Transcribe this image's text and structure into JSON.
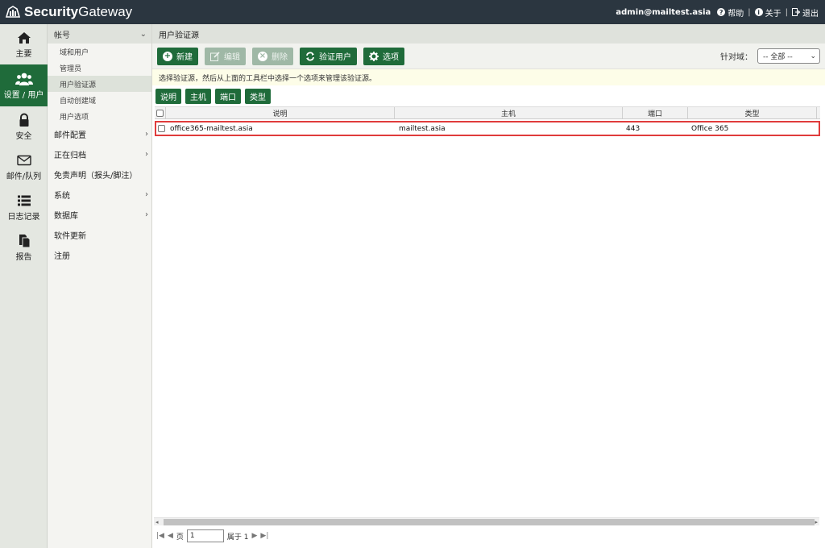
{
  "app": {
    "brand_prefix": "Security",
    "brand_suffix": "Gateway"
  },
  "top": {
    "user": "admin@mailtest.asia",
    "help": "帮助",
    "about": "关于",
    "logout": "退出"
  },
  "nav": {
    "items": [
      {
        "label": "主要",
        "icon": "home-icon"
      },
      {
        "label": "设置 / 用户",
        "icon": "users-icon",
        "active": true
      },
      {
        "label": "安全",
        "icon": "lock-icon"
      },
      {
        "label": "邮件/队列",
        "icon": "envelope-icon"
      },
      {
        "label": "日志记录",
        "icon": "list-icon"
      },
      {
        "label": "报告",
        "icon": "report-icon"
      }
    ]
  },
  "submenu": {
    "header": "帐号",
    "subitems": [
      "域和用户",
      "管理员",
      "用户验证源",
      "自动创建域",
      "用户选项"
    ],
    "active_subitem": "用户验证源",
    "items": [
      "邮件配置",
      "正在归档",
      "免责声明（报头/脚注）",
      "系统",
      "数据库",
      "软件更新",
      "注册"
    ]
  },
  "main": {
    "title": "用户验证源",
    "toolbar": {
      "new": "新建",
      "edit": "编辑",
      "delete": "删除",
      "verify": "验证用户",
      "options": "选项",
      "filter_label": "针对域：",
      "filter_value": "-- 全部 --"
    },
    "hint": "选择验证源，然后从上面的工具栏中选择一个选项来管理该验证源。",
    "column_buttons": [
      "说明",
      "主机",
      "端口",
      "类型"
    ],
    "columns": [
      "说明",
      "主机",
      "端口",
      "类型"
    ],
    "rows": [
      {
        "description": "office365-mailtest.asia",
        "host": "mailtest.asia",
        "port": "443",
        "type": "Office 365"
      }
    ],
    "pager": {
      "page_label": "页",
      "page_value": "1",
      "of_label": "属于 1"
    }
  },
  "colors": {
    "accent": "#1f6b3a",
    "topbar": "#2b3640",
    "highlight": "#e03c3c"
  }
}
